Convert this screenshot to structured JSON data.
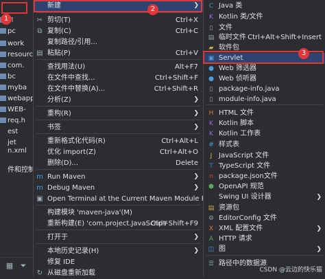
{
  "tree": {
    "rows": [
      {
        "label": "M",
        "color": "#9aa0a8"
      },
      {
        "label": "pc",
        "color": "#dfe1e5"
      },
      {
        "label": "work",
        "color": "#dfe1e5"
      },
      {
        "label": "resource",
        "color": "#dfe1e5"
      },
      {
        "label": "com.",
        "color": "#dfe1e5"
      },
      {
        "label": "bc",
        "color": "#dfe1e5"
      },
      {
        "label": "myba",
        "color": "#dfe1e5"
      },
      {
        "label": "webapp",
        "color": "#dfe1e5"
      },
      {
        "label": "WEB-",
        "color": "#dfe1e5"
      },
      {
        "label": "req.h",
        "color": "#dfe1e5"
      },
      {
        "label": "est",
        "color": "#dfe1e5"
      },
      {
        "label": "jet",
        "color": "#dfe1e5"
      },
      {
        "label": "n.xml",
        "color": "#dfe1e5"
      },
      {
        "label": "件和控制台",
        "color": "#dfe1e5"
      }
    ]
  },
  "main_menu": {
    "items": [
      {
        "label": "新建",
        "shortcut": "",
        "submenu": true,
        "icon": "",
        "selected": true
      },
      {
        "label": "剪切(T)",
        "shortcut": "Ctrl+X",
        "icon": "scissors-icon"
      },
      {
        "label": "复制(C)",
        "shortcut": "Ctrl+C",
        "icon": "copy-icon"
      },
      {
        "label": "复制路径/引用...",
        "shortcut": "",
        "icon": ""
      },
      {
        "label": "粘贴(P)",
        "shortcut": "Ctrl+V",
        "icon": "paste-icon"
      },
      {
        "label": "查找用法(U)",
        "shortcut": "Alt+F7",
        "icon": ""
      },
      {
        "label": "在文件中查找...",
        "shortcut": "Ctrl+Shift+F",
        "icon": ""
      },
      {
        "label": "在文件中替换(A)...",
        "shortcut": "Ctrl+Shift+R",
        "icon": ""
      },
      {
        "label": "分析(Z)",
        "shortcut": "",
        "submenu": true,
        "icon": ""
      },
      {
        "label": "重构(R)",
        "shortcut": "",
        "submenu": true,
        "icon": ""
      },
      {
        "label": "书签",
        "shortcut": "",
        "submenu": true,
        "icon": ""
      },
      {
        "label": "重新格式化代码(R)",
        "shortcut": "Ctrl+Alt+L",
        "icon": ""
      },
      {
        "label": "优化 import(Z)",
        "shortcut": "Ctrl+Alt+O",
        "icon": ""
      },
      {
        "label": "删除(D)...",
        "shortcut": "Delete",
        "icon": ""
      },
      {
        "label": "Run Maven",
        "shortcut": "",
        "submenu": true,
        "icon": "maven-icon"
      },
      {
        "label": "Debug Maven",
        "shortcut": "",
        "submenu": true,
        "icon": "maven-icon"
      },
      {
        "label": "Open Terminal at the Current Maven Module Path",
        "shortcut": "",
        "icon": "terminal-icon"
      },
      {
        "label": "构建模块 'maven-java'(M)",
        "shortcut": "",
        "icon": ""
      },
      {
        "label": "重新构建(E) 'com.project.JavaScript'",
        "shortcut": "Ctrl+Shift+F9",
        "icon": ""
      },
      {
        "label": "打开于",
        "shortcut": "",
        "submenu": true,
        "icon": ""
      },
      {
        "label": "本地历史记录(H)",
        "shortcut": "",
        "submenu": true,
        "icon": ""
      },
      {
        "label": "修复 IDE",
        "shortcut": "",
        "icon": ""
      },
      {
        "label": "从磁盘重新加载",
        "shortcut": "",
        "icon": "reload-icon"
      }
    ]
  },
  "sub_menu": {
    "items": [
      {
        "label": "Java 类",
        "shortcut": "",
        "icon": "java-class-icon",
        "icolor": "#3d8fd1",
        "glyph": "C"
      },
      {
        "label": "Kotlin 类/文件",
        "shortcut": "",
        "icon": "kotlin-icon",
        "icolor": "#9b6cf0",
        "glyph": "K"
      },
      {
        "label": "文件",
        "shortcut": "",
        "icon": "file-icon",
        "icolor": "#9aa0a8",
        "glyph": "▯"
      },
      {
        "label": "临时文件",
        "shortcut": "Ctrl+Alt+Shift+Insert",
        "icon": "scratch-file-icon",
        "icolor": "#9aa0a8",
        "glyph": "▤"
      },
      {
        "label": "软件包",
        "shortcut": "",
        "icon": "package-icon",
        "icolor": "#c9a74b",
        "glyph": "▰"
      },
      {
        "label": "Servlet",
        "shortcut": "",
        "icon": "servlet-icon",
        "icolor": "#4a9de0",
        "glyph": "▣",
        "selected": true
      },
      {
        "label": "Web 筛选器",
        "shortcut": "",
        "icon": "filter-icon",
        "icolor": "#4a9de0",
        "glyph": "●"
      },
      {
        "label": "Web 侦听器",
        "shortcut": "",
        "icon": "listener-icon",
        "icolor": "#4a9de0",
        "glyph": "●"
      },
      {
        "label": "package-info.java",
        "shortcut": "",
        "icon": "java-file-icon",
        "icolor": "#9aa0a8",
        "glyph": "▯"
      },
      {
        "label": "module-info.java",
        "shortcut": "",
        "icon": "java-file-icon",
        "icolor": "#9aa0a8",
        "glyph": "▯"
      },
      {
        "label": "HTML 文件",
        "shortcut": "",
        "icon": "html-icon",
        "icolor": "#e07b39",
        "glyph": "H"
      },
      {
        "label": "Kotlin 脚本",
        "shortcut": "",
        "icon": "kotlin-icon",
        "icolor": "#9b6cf0",
        "glyph": "K"
      },
      {
        "label": "Kotlin 工作表",
        "shortcut": "",
        "icon": "kotlin-icon",
        "icolor": "#9b6cf0",
        "glyph": "K"
      },
      {
        "label": "样式表",
        "shortcut": "",
        "icon": "css-icon",
        "icolor": "#4a9de0",
        "glyph": "#"
      },
      {
        "label": "JavaScript 文件",
        "shortcut": "",
        "icon": "js-icon",
        "icolor": "#e0c239",
        "glyph": "J"
      },
      {
        "label": "TypeScript 文件",
        "shortcut": "",
        "icon": "ts-icon",
        "icolor": "#3d7fd1",
        "glyph": "T"
      },
      {
        "label": "package.json文件",
        "shortcut": "",
        "icon": "npm-icon",
        "icolor": "#cc3b3b",
        "glyph": "n"
      },
      {
        "label": "OpenAPI 规范",
        "shortcut": "",
        "icon": "openapi-icon",
        "icolor": "#5ba85b",
        "glyph": "⬢"
      },
      {
        "label": "Swing UI 设计器",
        "shortcut": "",
        "submenu": true,
        "icon": "",
        "icolor": "",
        "glyph": ""
      },
      {
        "label": "资源包",
        "shortcut": "",
        "icon": "resource-bundle-icon",
        "icolor": "#c9a74b",
        "glyph": "▤"
      },
      {
        "label": "EditorConfig 文件",
        "shortcut": "",
        "icon": "editorconfig-icon",
        "icolor": "#9aa0a8",
        "glyph": "⚙"
      },
      {
        "label": "XML 配置文件",
        "shortcut": "",
        "submenu": true,
        "icon": "xml-icon",
        "icolor": "#e07b39",
        "glyph": "X"
      },
      {
        "label": "HTTP 请求",
        "shortcut": "",
        "icon": "http-icon",
        "icolor": "#5ba85b",
        "glyph": "A"
      },
      {
        "label": "图",
        "shortcut": "",
        "submenu": true,
        "icon": "diagram-icon",
        "icolor": "#4a9de0",
        "glyph": "◫"
      },
      {
        "label": "路径中的数据源",
        "shortcut": "",
        "icon": "datasource-icon",
        "icolor": "#9aa0a8",
        "glyph": "☰"
      }
    ]
  },
  "annotations": {
    "badge1": "1",
    "badge2": "2",
    "badge3": "3",
    "watermark": "CSDN @云边的快乐猫"
  }
}
